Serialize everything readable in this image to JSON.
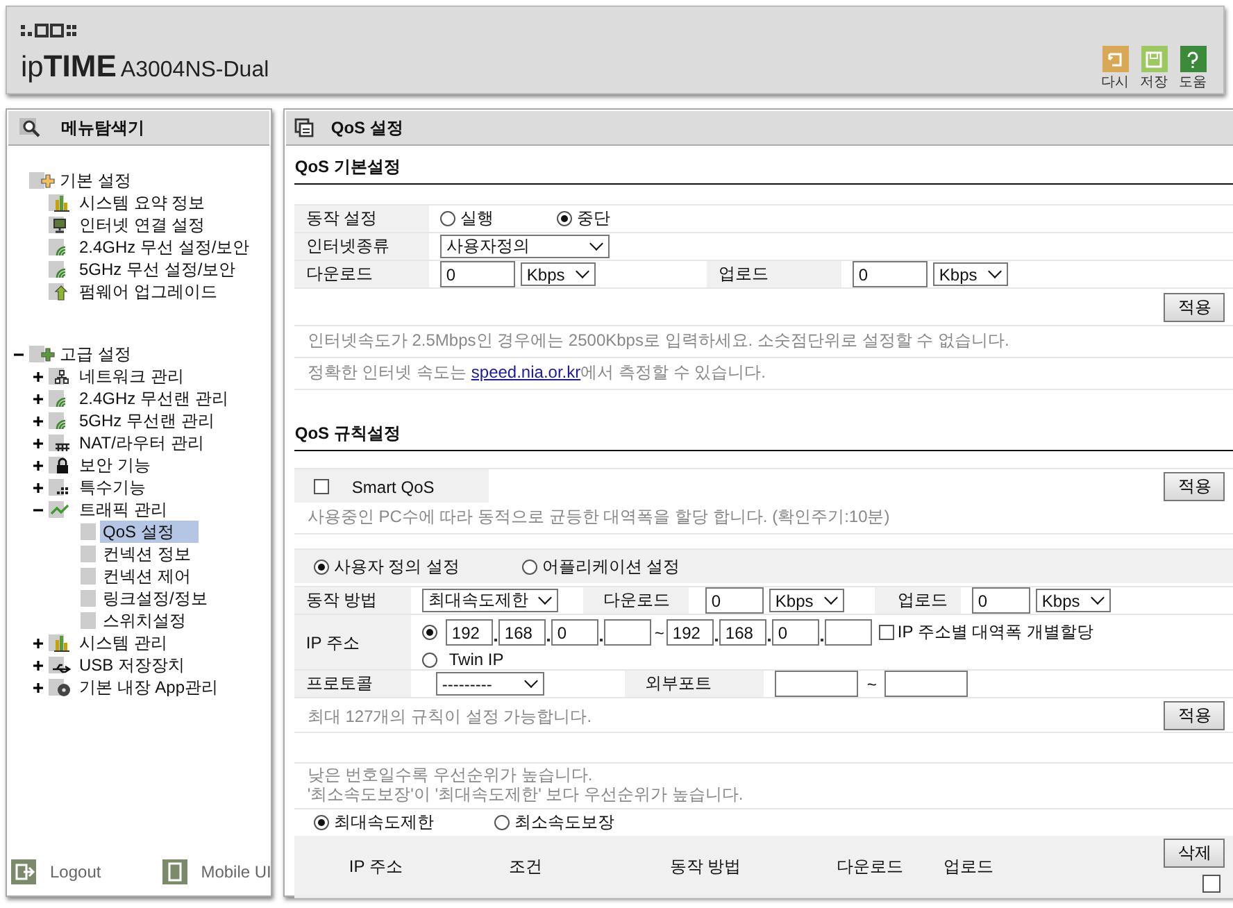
{
  "header": {
    "logo": "ip",
    "logo_bold": "TIME",
    "model": "A3004NS-Dual",
    "tools": [
      {
        "kind": "undo",
        "label": "다시"
      },
      {
        "kind": "save",
        "label": "저장"
      },
      {
        "kind": "help",
        "label": "도움"
      }
    ]
  },
  "sidebar": {
    "title": "메뉴탐색기",
    "tree": [
      {
        "label": "기본 설정",
        "selected": false,
        "children": [
          {
            "label": "시스템 요약 정보",
            "selected": false
          },
          {
            "label": "인터넷 연결 설정",
            "selected": false
          },
          {
            "label": "2.4GHz 무선 설정/보안",
            "selected": false
          },
          {
            "label": "5GHz 무선 설정/보안",
            "selected": false
          },
          {
            "label": "펌웨어 업그레이드",
            "selected": false
          }
        ]
      },
      {
        "label": "고급 설정",
        "expanded": true,
        "selected": false,
        "children": [
          {
            "label": "네트워크 관리",
            "expanded": false,
            "selected": false
          },
          {
            "label": "2.4GHz 무선랜 관리",
            "expanded": false,
            "selected": false
          },
          {
            "label": "5GHz 무선랜 관리",
            "expanded": false,
            "selected": false
          },
          {
            "label": "NAT/라우터 관리",
            "expanded": false,
            "selected": false
          },
          {
            "label": "보안 기능",
            "expanded": false,
            "selected": false
          },
          {
            "label": "특수기능",
            "expanded": false,
            "selected": false
          },
          {
            "label": "트래픽 관리",
            "expanded": true,
            "selected": false,
            "children": [
              {
                "label": "QoS 설정",
                "selected": true
              },
              {
                "label": "컨넥션 정보",
                "selected": false
              },
              {
                "label": "컨넥션 제어",
                "selected": false
              },
              {
                "label": "링크설정/정보",
                "selected": false
              },
              {
                "label": "스위치설정",
                "selected": false
              }
            ]
          },
          {
            "label": "시스템 관리",
            "expanded": false,
            "selected": false
          },
          {
            "label": "USB 저장장치",
            "expanded": false,
            "selected": false
          },
          {
            "label": "기본 내장 App관리",
            "expanded": false,
            "selected": false
          }
        ]
      }
    ],
    "footer": [
      {
        "kind": "logout",
        "label": "Logout"
      },
      {
        "kind": "mobile",
        "label": "Mobile UI"
      }
    ]
  },
  "main": {
    "title": "QoS 설정",
    "basic": {
      "title": "QoS 기본설정",
      "mode_label": "동작 설정",
      "mode_options": [
        {
          "label": "실행",
          "selected": false
        },
        {
          "label": "중단",
          "selected": true
        }
      ],
      "type_label": "인터넷종류",
      "type_value": "사용자정의",
      "download_label": "다운로드",
      "download_value": "0",
      "download_unit": "Kbps",
      "upload_label": "업로드",
      "upload_value": "0",
      "upload_unit": "Kbps",
      "apply": "적용",
      "note": "인터넷속도가 2.5Mbps인 경우에는 2500Kbps로 입력하세요. 소숫점단위로 설정할 수 없습니다.",
      "speed_note": {
        "before": "정확한 인터넷 속도는 ",
        "link": "speed.nia.or.kr",
        "after": "에서 측정할 수 있습니다."
      }
    },
    "rules": {
      "title": "QoS 규칙설정",
      "smart_qos": {
        "label": "Smart QoS",
        "checked": false
      },
      "smart_apply": "적용",
      "smart_note": "사용중인 PC수에 따라 동적으로 균등한 대역폭을 할당 합니다. (확인주기:10분)",
      "setting_modes": [
        {
          "label": "사용자 정의 설정",
          "selected": true
        },
        {
          "label": "어플리케이션 설정",
          "selected": false
        }
      ],
      "method_label": "동작 방법",
      "method_value": "최대속도제한",
      "download_label": "다운로드",
      "download_value": "0",
      "download_unit": "Kbps",
      "upload_label": "업로드",
      "upload_value": "0",
      "upload_unit": "Kbps",
      "ip_label": "IP 주소",
      "ip_range": {
        "selected": true,
        "start": [
          "192",
          "168",
          "0"
        ],
        "separator": "~",
        "end": [
          "192",
          "168",
          "0"
        ]
      },
      "twin_ip": {
        "label": "Twin IP",
        "selected": false
      },
      "per_ip": {
        "label": "IP 주소별 대역폭 개별할당",
        "checked": false
      },
      "protocol_label": "프로토콜",
      "protocol_value": "---------",
      "port_label": "외부포트",
      "port_separator": "~",
      "limit_note": "최대 127개의 규칙이 설정 가능합니다.",
      "apply": "적용",
      "priority_notes": [
        "낮은 번호일수록 우선순위가 높습니다.",
        "'최소속도보장'이 '최대속도제한' 보다 우선순위가 높습니다."
      ],
      "list_modes": [
        {
          "label": "최대속도제한",
          "selected": true
        },
        {
          "label": "최소속도보장",
          "selected": false
        }
      ],
      "columns": [
        "IP 주소",
        "조건",
        "동작 방법",
        "다운로드",
        "업로드"
      ],
      "delete": "삭제",
      "select_all": {
        "checked": false
      }
    }
  }
}
